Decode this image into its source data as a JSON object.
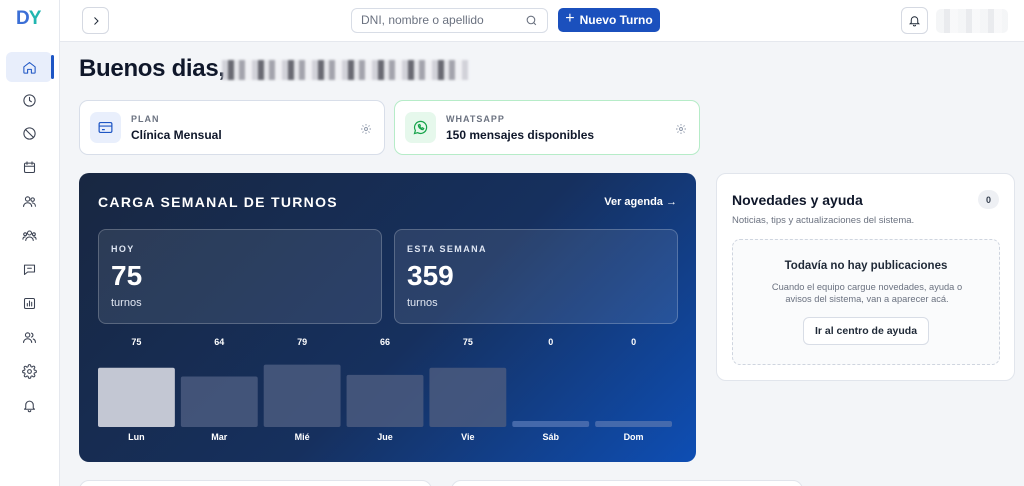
{
  "app": {
    "logo_text": "D",
    "logo_accent": "Y"
  },
  "sidebar": {
    "items": [
      {
        "name": "home",
        "active": true
      },
      {
        "name": "history",
        "active": false
      },
      {
        "name": "blocked",
        "active": false
      },
      {
        "name": "calendar",
        "active": false
      },
      {
        "name": "patients",
        "active": false
      },
      {
        "name": "team",
        "active": false
      },
      {
        "name": "messages",
        "active": false
      },
      {
        "name": "reports",
        "active": false
      },
      {
        "name": "users",
        "active": false
      },
      {
        "name": "settings",
        "active": false
      },
      {
        "name": "notifications",
        "active": false
      }
    ]
  },
  "header": {
    "search_placeholder": "DNI, nombre o apellido",
    "new_button_label": "Nuevo Turno"
  },
  "greeting": {
    "text": "Buenos dias,"
  },
  "plan_card": {
    "label": "PLAN",
    "value": "Clínica Mensual"
  },
  "whatsapp_card": {
    "label": "WHATSAPP",
    "value": "150 mensajes disponibles"
  },
  "weekly_load": {
    "title": "CARGA SEMANAL DE TURNOS",
    "link_label": "Ver agenda →",
    "today": {
      "label": "HOY",
      "value": "75",
      "unit": "turnos"
    },
    "week": {
      "label": "ESTA SEMANA",
      "value": "359",
      "unit": "turnos"
    }
  },
  "chart_data": {
    "type": "bar",
    "categories": [
      "Lun",
      "Mar",
      "Mié",
      "Jue",
      "Vie",
      "Sáb",
      "Dom"
    ],
    "values": [
      75,
      64,
      79,
      66,
      75,
      0,
      0
    ],
    "title": "",
    "xlabel": "",
    "ylabel": "",
    "ylim": [
      0,
      100
    ]
  },
  "news": {
    "title": "Novedades y ayuda",
    "count": "0",
    "subtitle": "Noticias, tips y actualizaciones del sistema.",
    "empty_title": "Todavía no hay publicaciones",
    "empty_desc": "Cuando el equipo cargue novedades, ayuda o avisos del sistema, van a aparecer acá.",
    "help_button": "Ir al centro de ayuda"
  }
}
